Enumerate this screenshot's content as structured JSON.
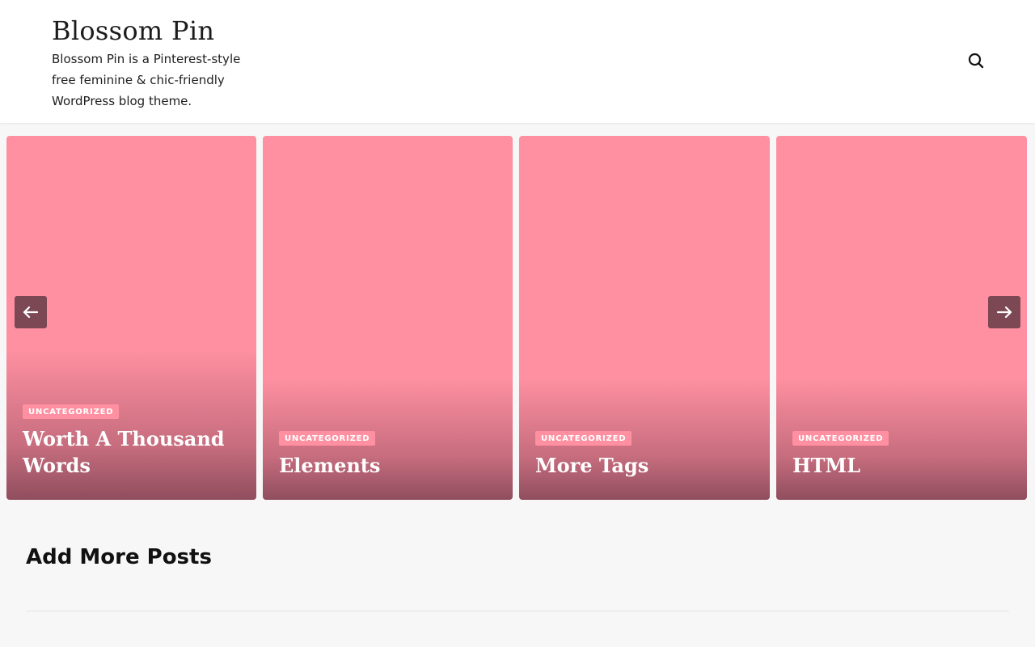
{
  "site": {
    "title": "Blossom Pin",
    "description": "Blossom Pin is a Pinterest-style free feminine & chic-friendly WordPress blog theme."
  },
  "header": {
    "search_icon": "search-icon"
  },
  "slider": {
    "prev_icon": "arrow-left-icon",
    "next_icon": "arrow-right-icon",
    "colors": {
      "card": "#fe90a1",
      "arrow_bg": "#7b4854"
    },
    "posts": [
      {
        "category": "UNCATEGORIZED",
        "title": "Worth A Thousand Words"
      },
      {
        "category": "UNCATEGORIZED",
        "title": "Elements"
      },
      {
        "category": "UNCATEGORIZED",
        "title": "More Tags"
      },
      {
        "category": "UNCATEGORIZED",
        "title": "HTML"
      }
    ]
  },
  "section": {
    "title": "Add More Posts"
  }
}
